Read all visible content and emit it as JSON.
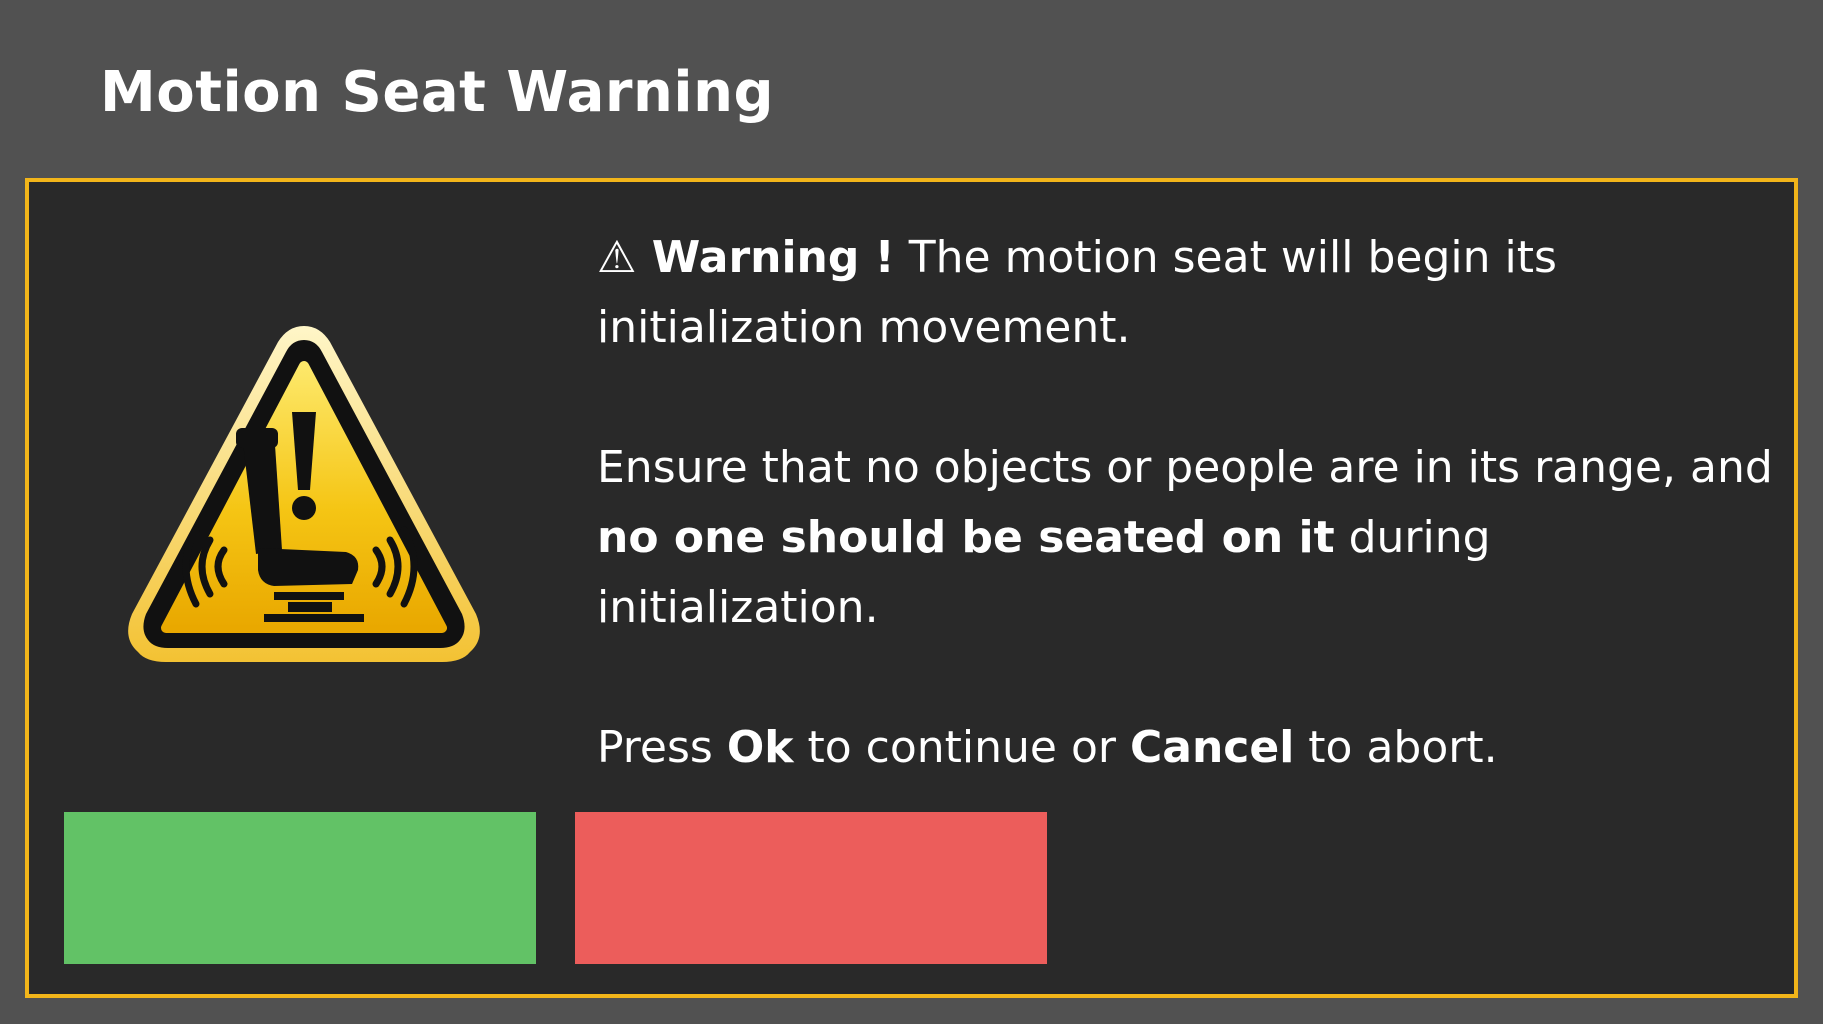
{
  "window": {
    "title": "Motion Seat Warning"
  },
  "colors": {
    "background": "#515151",
    "dialog_background": "#292929",
    "dialog_border": "#f2b51a",
    "ok_button": "#62c266",
    "cancel_button": "#ec5d5b",
    "icon_yellow": "#f5c514"
  },
  "icon": {
    "name": "motion-seat-warning-icon"
  },
  "message": {
    "warning_glyph": "⚠",
    "warning_label": "Warning !",
    "line1_rest": "The motion seat will begin its initialization movement.",
    "p2_before": "Ensure that no objects or people are in its range, and",
    "p2_bold": "no one should be seated on it",
    "p2_after": "during initialization.",
    "p3_press": "Press",
    "p3_ok": "Ok",
    "p3_middle": "to continue or",
    "p3_cancel": "Cancel",
    "p3_end": "to abort."
  },
  "buttons": {
    "ok_label": "",
    "cancel_label": ""
  }
}
